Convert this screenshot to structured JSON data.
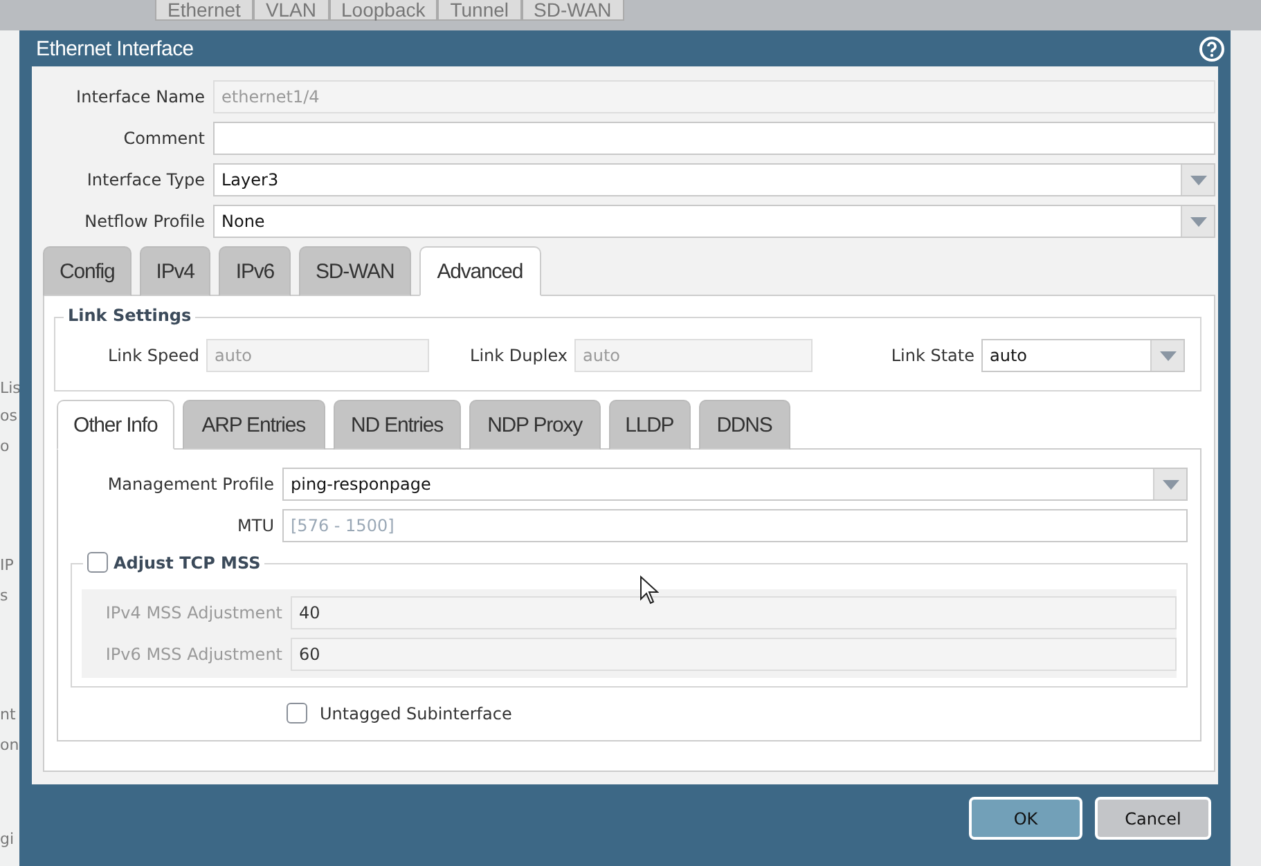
{
  "background": {
    "tabs": [
      {
        "label": "Ethernet"
      },
      {
        "label": "VLAN"
      },
      {
        "label": "Loopback"
      },
      {
        "label": "Tunnel"
      },
      {
        "label": "SD-WAN"
      }
    ],
    "side_fragments": [
      "Lis",
      "os",
      "o",
      "IP",
      "s",
      "nt",
      "on",
      "gi"
    ]
  },
  "dialog": {
    "title": "Ethernet Interface",
    "fields": [
      {
        "label": "Interface Name",
        "kind": "readonly",
        "value": "ethernet1/4"
      },
      {
        "label": "Comment",
        "kind": "text"
      },
      {
        "label": "Interface Type",
        "kind": "select",
        "value": "Layer3"
      },
      {
        "label": "Netflow Profile",
        "kind": "select",
        "value": "None"
      }
    ],
    "tabs": [
      {
        "label": "Config",
        "selected": false
      },
      {
        "label": "IPv4",
        "selected": false
      },
      {
        "label": "IPv6",
        "selected": false
      },
      {
        "label": "SD-WAN",
        "selected": false
      },
      {
        "label": "Advanced",
        "selected": true
      }
    ],
    "link_settings": {
      "title": "Link Settings",
      "fields": [
        {
          "label": "Link Speed",
          "kind": "readonly",
          "value": "auto"
        },
        {
          "label": "Link Duplex",
          "kind": "readonly",
          "value": "auto"
        },
        {
          "label": "Link State",
          "kind": "select",
          "value": "auto"
        }
      ]
    },
    "subtabs": [
      {
        "label": "Other Info",
        "selected": true
      },
      {
        "label": "ARP Entries",
        "selected": false
      },
      {
        "label": "ND Entries",
        "selected": false
      },
      {
        "label": "NDP Proxy",
        "selected": false
      },
      {
        "label": "LLDP",
        "selected": false
      },
      {
        "label": "DDNS",
        "selected": false
      }
    ],
    "other_info": {
      "fields": [
        {
          "label": "Management Profile",
          "kind": "select",
          "value": "ping-responpage"
        },
        {
          "label": "MTU",
          "kind": "text",
          "placeholder": "[576 - 1500]"
        }
      ],
      "adjust_tcp_mss": {
        "label": "Adjust TCP MSS",
        "checked": false,
        "fields": [
          {
            "label": "IPv4 MSS Adjustment",
            "value": "40"
          },
          {
            "label": "IPv6 MSS Adjustment",
            "value": "60"
          }
        ]
      },
      "untagged": {
        "label": "Untagged Subinterface",
        "checked": false
      }
    },
    "buttons": [
      {
        "label": "OK",
        "kind": "primary"
      },
      {
        "label": "Cancel",
        "kind": "secondary"
      }
    ]
  }
}
